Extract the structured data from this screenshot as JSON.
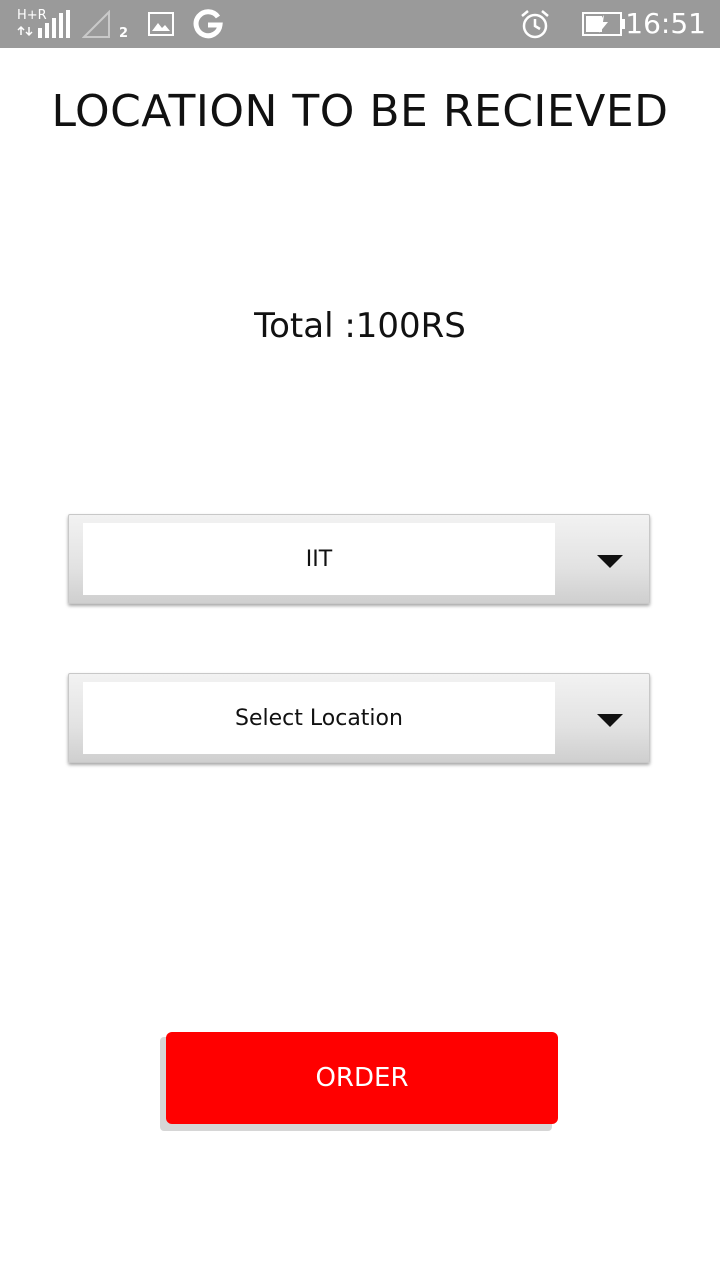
{
  "status_bar": {
    "network_label": "H+R",
    "sim_number": "2",
    "time": "16:51",
    "icons": [
      "signal-icon",
      "sim2-signal-icon",
      "image-notification-icon",
      "google-icon",
      "alarm-icon",
      "battery-charging-icon"
    ],
    "background_color": "#9a9a9a"
  },
  "page": {
    "title": "LOCATION TO BE RECIEVED",
    "total": "Total :100RS"
  },
  "spinners": {
    "first": {
      "selected_value": "IIT"
    },
    "second": {
      "selected_value": "Select Location"
    }
  },
  "order": {
    "label": "ORDER",
    "color": "#ff0000"
  }
}
